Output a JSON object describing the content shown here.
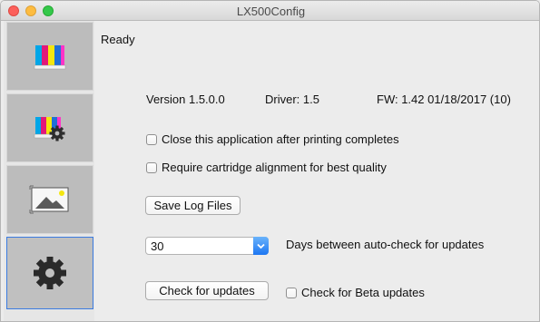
{
  "window": {
    "title": "LX500Config"
  },
  "sidebar": {
    "tabs": [
      {
        "icon": "color-bars-icon",
        "selected": false
      },
      {
        "icon": "color-bars-gear-icon",
        "selected": false
      },
      {
        "icon": "image-icon",
        "selected": false
      },
      {
        "icon": "gear-icon",
        "selected": true
      }
    ]
  },
  "main": {
    "status": "Ready",
    "version": "Version 1.5.0.0",
    "driver": "Driver: 1.5",
    "firmware": "FW: 1.42  01/18/2017 (10)",
    "close_after_printing_label": "Close this application after printing completes",
    "close_after_printing_checked": false,
    "require_alignment_label": "Require cartridge alignment for best quality",
    "require_alignment_checked": false,
    "save_log_button": "Save Log Files",
    "days_value": "30",
    "days_label": "Days between auto-check for updates",
    "check_updates_button": "Check for updates",
    "beta_updates_label": "Check for Beta updates",
    "beta_updates_checked": false
  },
  "colors": {
    "accent": "#1d76f2",
    "tab_background": "#bcbcbc",
    "window_background": "#ececec"
  }
}
